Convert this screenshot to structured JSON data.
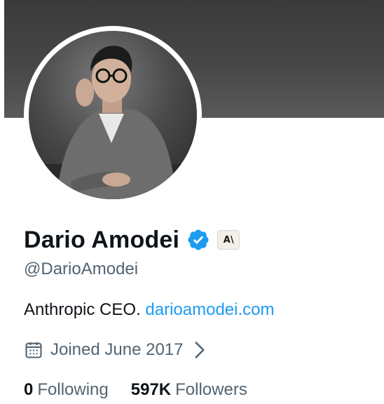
{
  "profile": {
    "name": "Dario Amodei",
    "handle": "@DarioAmodei",
    "bio_text": "Anthropic CEO. ",
    "bio_link": "darioamodei.com",
    "affiliate_badge": "A\\",
    "joined": "Joined June 2017"
  },
  "stats": {
    "following_count": "0",
    "following_label": "Following",
    "followers_count": "597K",
    "followers_label": "Followers"
  },
  "icons": {
    "verified": "verified-badge-icon",
    "calendar": "calendar-icon",
    "chevron": "chevron-right-icon"
  },
  "colors": {
    "verified_blue": "#1d9bf0",
    "link_blue": "#1d9bf0",
    "secondary_text": "#536471",
    "primary_text": "#0f1419"
  }
}
